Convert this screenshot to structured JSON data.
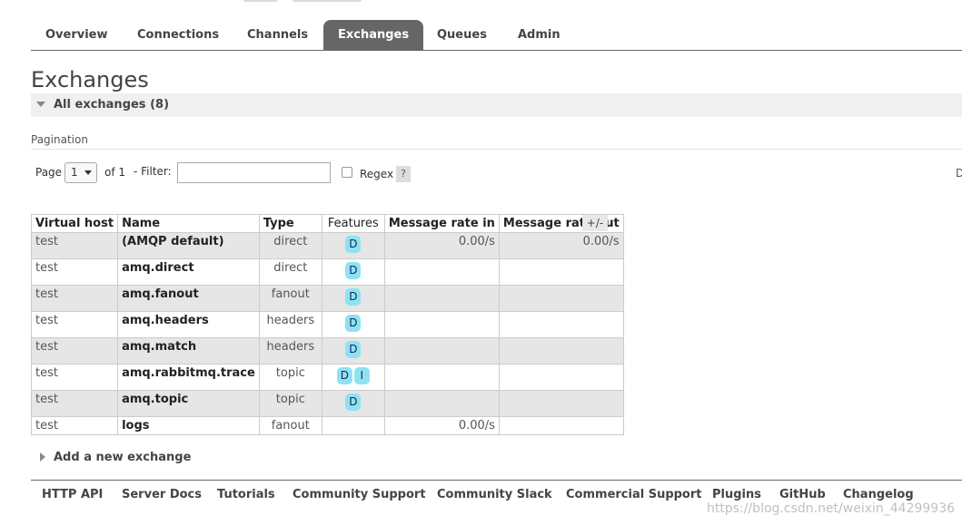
{
  "tabs": {
    "overview": "Overview",
    "connections": "Connections",
    "channels": "Channels",
    "exchanges": "Exchanges",
    "queues": "Queues",
    "admin": "Admin"
  },
  "page_title": "Exchanges",
  "section": {
    "title": "All exchanges (8)"
  },
  "pagination": {
    "label": "Pagination",
    "page_label": "Page",
    "page_value": "1",
    "of_label": "of 1",
    "filter_label": "- Filter:",
    "filter_value": "",
    "regex_label": "Regex",
    "help_label": "?",
    "right_edge_text": "D"
  },
  "table": {
    "headers": {
      "vhost": "Virtual host",
      "name": "Name",
      "type": "Type",
      "features": "Features",
      "rate_in": "Message rate in",
      "rate_out": "Message rate out"
    },
    "column_toggle": "+/-",
    "rows": [
      {
        "vhost": "test",
        "name": "(AMQP default)",
        "type": "direct",
        "features": [
          "D"
        ],
        "rate_in": "0.00/s",
        "rate_out": "0.00/s"
      },
      {
        "vhost": "test",
        "name": "amq.direct",
        "type": "direct",
        "features": [
          "D"
        ],
        "rate_in": "",
        "rate_out": ""
      },
      {
        "vhost": "test",
        "name": "amq.fanout",
        "type": "fanout",
        "features": [
          "D"
        ],
        "rate_in": "",
        "rate_out": ""
      },
      {
        "vhost": "test",
        "name": "amq.headers",
        "type": "headers",
        "features": [
          "D"
        ],
        "rate_in": "",
        "rate_out": ""
      },
      {
        "vhost": "test",
        "name": "amq.match",
        "type": "headers",
        "features": [
          "D"
        ],
        "rate_in": "",
        "rate_out": ""
      },
      {
        "vhost": "test",
        "name": "amq.rabbitmq.trace",
        "type": "topic",
        "features": [
          "D",
          "I"
        ],
        "rate_in": "",
        "rate_out": ""
      },
      {
        "vhost": "test",
        "name": "amq.topic",
        "type": "topic",
        "features": [
          "D"
        ],
        "rate_in": "",
        "rate_out": ""
      },
      {
        "vhost": "test",
        "name": "logs",
        "type": "fanout",
        "features": [],
        "rate_in": "0.00/s",
        "rate_out": ""
      }
    ]
  },
  "add_exchange": {
    "label": "Add a new exchange"
  },
  "footer": {
    "http_api": "HTTP API",
    "server_docs": "Server Docs",
    "tutorials": "Tutorials",
    "community_support": "Community Support",
    "community_slack": "Community Slack",
    "commercial_support": "Commercial Support",
    "plugins": "Plugins",
    "github": "GitHub",
    "changelog": "Changelog"
  },
  "watermark": "https://blog.csdn.net/weixin_44299936",
  "colors": {
    "active_tab": "#666666",
    "badge": "#8ee3f2",
    "alt_row": "#e6e6e6"
  }
}
